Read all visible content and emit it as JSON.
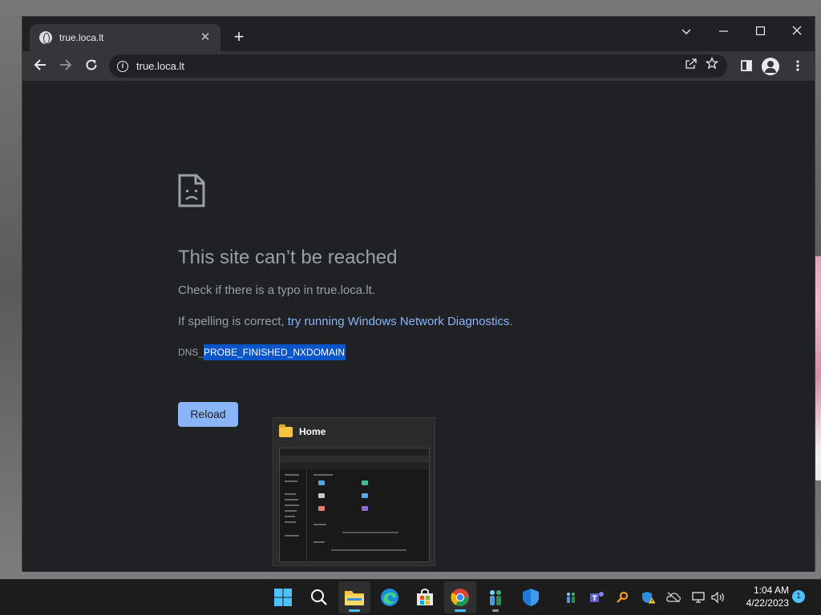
{
  "browser": {
    "tab_title": "true.loca.lt",
    "tab_close": "✕",
    "new_tab": "+",
    "url": "true.loca.lt"
  },
  "error": {
    "title": "This site can’t be reached",
    "typo_line": "Check if there is a typo in true.loca.lt.",
    "spelling_prefix": "If spelling is correct, ",
    "diagnostics_link": "try running Windows Network Diagnostics",
    "spelling_suffix": ".",
    "code_prefix": "DNS_",
    "code_selected": "PROBE_FINISHED_NXDOMAIN",
    "reload_label": "Reload"
  },
  "preview": {
    "title": "Home"
  },
  "taskbar": {
    "time": "1:04 AM",
    "date": "4/22/2023",
    "notification_count": "1",
    "accent": "#4cc2ff"
  },
  "colors": {
    "link": "#8ab4f8",
    "selection": "#0a55c8",
    "page_bg": "#202124"
  }
}
